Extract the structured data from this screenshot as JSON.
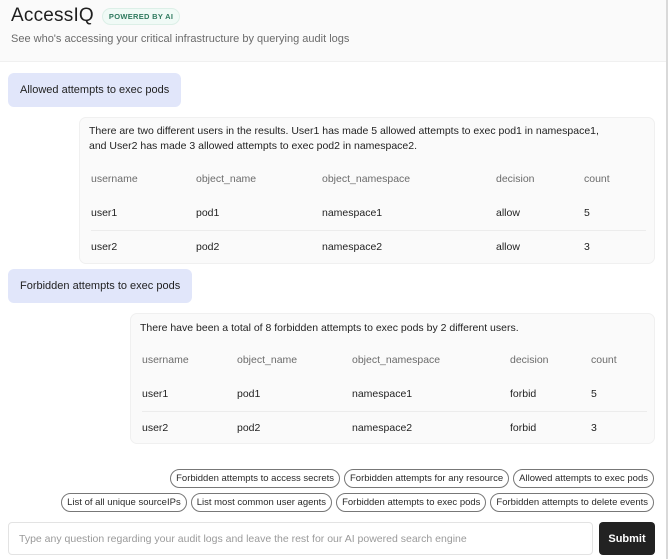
{
  "header": {
    "app_title": "AccessIQ",
    "badge": "POWERED BY AI",
    "subtitle": "See who's accessing your critical infrastructure by querying audit logs"
  },
  "conversation": [
    {
      "query": "Allowed attempts to exec pods",
      "answer": "There are two different users in the results. User1 has made 5 allowed attempts to exec pod1 in namespace1, and User2 has made 3 allowed attempts to exec pod2 in namespace2.",
      "columns": [
        "username",
        "object_name",
        "object_namespace",
        "decision",
        "count"
      ],
      "rows": [
        [
          "user1",
          "pod1",
          "namespace1",
          "allow",
          "5"
        ],
        [
          "user2",
          "pod2",
          "namespace2",
          "allow",
          "3"
        ]
      ]
    },
    {
      "query": "Forbidden attempts to exec pods",
      "answer": "There have been a total of 8 forbidden attempts to exec pods by 2 different users.",
      "columns": [
        "username",
        "object_name",
        "object_namespace",
        "decision",
        "count"
      ],
      "rows": [
        [
          "user1",
          "pod1",
          "namespace1",
          "forbid",
          "5"
        ],
        [
          "user2",
          "pod2",
          "namespace2",
          "forbid",
          "3"
        ]
      ]
    }
  ],
  "suggestions": {
    "row1": [
      "Forbidden attempts to access secrets",
      "Forbidden attempts for any resource",
      "Allowed attempts to exec pods"
    ],
    "row2": [
      "List of all unique sourceIPs",
      "List most common user agents",
      "Forbidden attempts to exec pods",
      "Forbidden attempts to delete events"
    ]
  },
  "search": {
    "value": "",
    "placeholder": "Type any question regarding your audit logs and leave the rest for our AI powered search engine",
    "submit_label": "Submit"
  }
}
